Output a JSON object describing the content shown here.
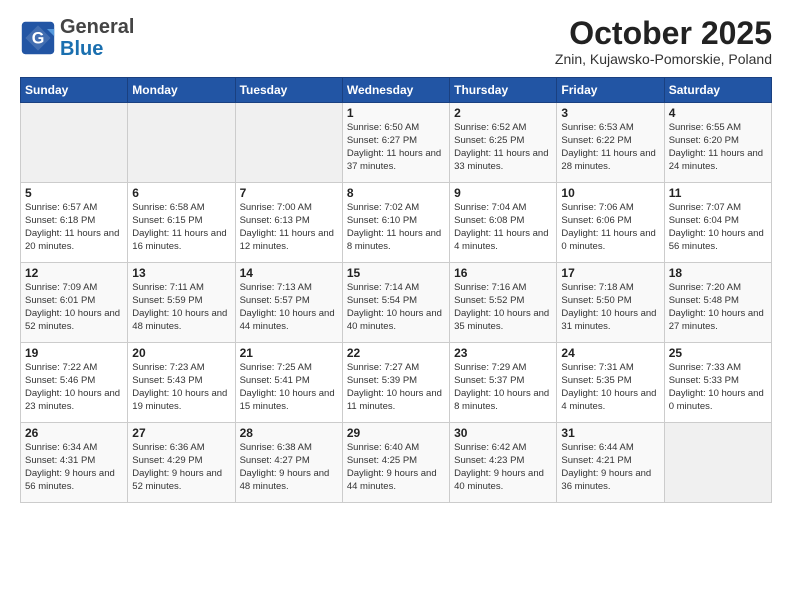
{
  "header": {
    "logo_general": "General",
    "logo_blue": "Blue",
    "month_title": "October 2025",
    "subtitle": "Znin, Kujawsko-Pomorskie, Poland"
  },
  "days_of_week": [
    "Sunday",
    "Monday",
    "Tuesday",
    "Wednesday",
    "Thursday",
    "Friday",
    "Saturday"
  ],
  "weeks": [
    [
      {
        "day": "",
        "info": ""
      },
      {
        "day": "",
        "info": ""
      },
      {
        "day": "",
        "info": ""
      },
      {
        "day": "1",
        "info": "Sunrise: 6:50 AM\nSunset: 6:27 PM\nDaylight: 11 hours\nand 37 minutes."
      },
      {
        "day": "2",
        "info": "Sunrise: 6:52 AM\nSunset: 6:25 PM\nDaylight: 11 hours\nand 33 minutes."
      },
      {
        "day": "3",
        "info": "Sunrise: 6:53 AM\nSunset: 6:22 PM\nDaylight: 11 hours\nand 28 minutes."
      },
      {
        "day": "4",
        "info": "Sunrise: 6:55 AM\nSunset: 6:20 PM\nDaylight: 11 hours\nand 24 minutes."
      }
    ],
    [
      {
        "day": "5",
        "info": "Sunrise: 6:57 AM\nSunset: 6:18 PM\nDaylight: 11 hours\nand 20 minutes."
      },
      {
        "day": "6",
        "info": "Sunrise: 6:58 AM\nSunset: 6:15 PM\nDaylight: 11 hours\nand 16 minutes."
      },
      {
        "day": "7",
        "info": "Sunrise: 7:00 AM\nSunset: 6:13 PM\nDaylight: 11 hours\nand 12 minutes."
      },
      {
        "day": "8",
        "info": "Sunrise: 7:02 AM\nSunset: 6:10 PM\nDaylight: 11 hours\nand 8 minutes."
      },
      {
        "day": "9",
        "info": "Sunrise: 7:04 AM\nSunset: 6:08 PM\nDaylight: 11 hours\nand 4 minutes."
      },
      {
        "day": "10",
        "info": "Sunrise: 7:06 AM\nSunset: 6:06 PM\nDaylight: 11 hours\nand 0 minutes."
      },
      {
        "day": "11",
        "info": "Sunrise: 7:07 AM\nSunset: 6:04 PM\nDaylight: 10 hours\nand 56 minutes."
      }
    ],
    [
      {
        "day": "12",
        "info": "Sunrise: 7:09 AM\nSunset: 6:01 PM\nDaylight: 10 hours\nand 52 minutes."
      },
      {
        "day": "13",
        "info": "Sunrise: 7:11 AM\nSunset: 5:59 PM\nDaylight: 10 hours\nand 48 minutes."
      },
      {
        "day": "14",
        "info": "Sunrise: 7:13 AM\nSunset: 5:57 PM\nDaylight: 10 hours\nand 44 minutes."
      },
      {
        "day": "15",
        "info": "Sunrise: 7:14 AM\nSunset: 5:54 PM\nDaylight: 10 hours\nand 40 minutes."
      },
      {
        "day": "16",
        "info": "Sunrise: 7:16 AM\nSunset: 5:52 PM\nDaylight: 10 hours\nand 35 minutes."
      },
      {
        "day": "17",
        "info": "Sunrise: 7:18 AM\nSunset: 5:50 PM\nDaylight: 10 hours\nand 31 minutes."
      },
      {
        "day": "18",
        "info": "Sunrise: 7:20 AM\nSunset: 5:48 PM\nDaylight: 10 hours\nand 27 minutes."
      }
    ],
    [
      {
        "day": "19",
        "info": "Sunrise: 7:22 AM\nSunset: 5:46 PM\nDaylight: 10 hours\nand 23 minutes."
      },
      {
        "day": "20",
        "info": "Sunrise: 7:23 AM\nSunset: 5:43 PM\nDaylight: 10 hours\nand 19 minutes."
      },
      {
        "day": "21",
        "info": "Sunrise: 7:25 AM\nSunset: 5:41 PM\nDaylight: 10 hours\nand 15 minutes."
      },
      {
        "day": "22",
        "info": "Sunrise: 7:27 AM\nSunset: 5:39 PM\nDaylight: 10 hours\nand 11 minutes."
      },
      {
        "day": "23",
        "info": "Sunrise: 7:29 AM\nSunset: 5:37 PM\nDaylight: 10 hours\nand 8 minutes."
      },
      {
        "day": "24",
        "info": "Sunrise: 7:31 AM\nSunset: 5:35 PM\nDaylight: 10 hours\nand 4 minutes."
      },
      {
        "day": "25",
        "info": "Sunrise: 7:33 AM\nSunset: 5:33 PM\nDaylight: 10 hours\nand 0 minutes."
      }
    ],
    [
      {
        "day": "26",
        "info": "Sunrise: 6:34 AM\nSunset: 4:31 PM\nDaylight: 9 hours\nand 56 minutes."
      },
      {
        "day": "27",
        "info": "Sunrise: 6:36 AM\nSunset: 4:29 PM\nDaylight: 9 hours\nand 52 minutes."
      },
      {
        "day": "28",
        "info": "Sunrise: 6:38 AM\nSunset: 4:27 PM\nDaylight: 9 hours\nand 48 minutes."
      },
      {
        "day": "29",
        "info": "Sunrise: 6:40 AM\nSunset: 4:25 PM\nDaylight: 9 hours\nand 44 minutes."
      },
      {
        "day": "30",
        "info": "Sunrise: 6:42 AM\nSunset: 4:23 PM\nDaylight: 9 hours\nand 40 minutes."
      },
      {
        "day": "31",
        "info": "Sunrise: 6:44 AM\nSunset: 4:21 PM\nDaylight: 9 hours\nand 36 minutes."
      },
      {
        "day": "",
        "info": ""
      }
    ]
  ]
}
